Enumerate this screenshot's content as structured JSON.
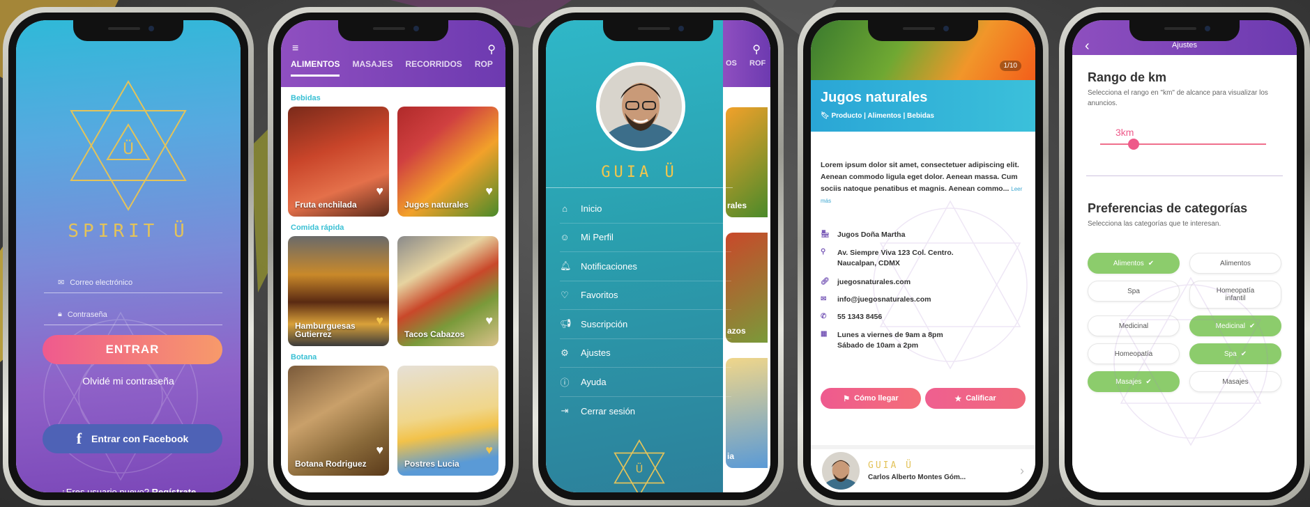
{
  "colors": {
    "accent_pink": "#ef5a8e",
    "purple": "#7b47b8",
    "teal": "#2fb7c8",
    "gold": "#e3c35a",
    "green_chip": "#8ccc6c"
  },
  "login": {
    "brand": "SPIRIT Ü",
    "email_placeholder": "Correo electrónico",
    "password_placeholder": "Contraseña",
    "login_button": "ENTRAR",
    "forgot": "Olvidé mi contraseña",
    "facebook_button": "Entrar con Facebook",
    "new_user": "¿Eres usuario nuevo?",
    "register": "Regístrate"
  },
  "catalog": {
    "tabs": [
      "ALIMENTOS",
      "MASAJES",
      "RECORRIDOS",
      "ROP"
    ],
    "sections": [
      {
        "title": "Bebidas",
        "items": [
          {
            "label": "Fruta enchilada"
          },
          {
            "label": "Jugos naturales"
          }
        ]
      },
      {
        "title": "Comida rápida",
        "items": [
          {
            "label": "Hamburguesas Gutierrez"
          },
          {
            "label": "Tacos Cabazos"
          }
        ]
      },
      {
        "title": "Botana",
        "items": [
          {
            "label": "Botana Rodriguez"
          },
          {
            "label": "Postres Lucia"
          }
        ]
      }
    ],
    "peek_tab": "OS",
    "peek_tab2": "ROF",
    "peek_labels": [
      "rales",
      "azos",
      "ia"
    ]
  },
  "menu": {
    "brand": "GUIA Ü",
    "items": [
      "Inicio",
      "Mi Perfil",
      "Notificaciones",
      "Favoritos",
      "Suscripción",
      "Ajustes",
      "Ayuda",
      "Cerrar sesión"
    ]
  },
  "detail": {
    "pager": "1/10",
    "title": "Jugos naturales",
    "subtitle": "Producto | Alimentos | Bebidas",
    "description": "Lorem ipsum dolor sit amet, consectetuer adipiscing elit. Aenean commodo ligula eget dolor. Aenean massa. Cum sociis natoque penatibus et magnis. Aenean commo...",
    "read_more": "Leer más",
    "business": "Jugos Doña Martha",
    "address": "Av. Siempre Viva 123 Col. Centro. Naucalpan, CDMX",
    "website": "juegosnaturales.com",
    "email": "info@juegosnaturales.com",
    "phone": "55 1343 8456",
    "hours": "Lunes a viernes de 9am a 8pm Sábado de 10am a 2pm",
    "directions_button": "Cómo llegar",
    "rate_button": "Calificar",
    "footer_brand": "GUIA Ü",
    "footer_name": "Carlos Alberto Montes Góm..."
  },
  "settings": {
    "title": "Ajustes",
    "range_title": "Rango de km",
    "range_desc": "Selecciona el rango en \"km\" de alcance para visualizar los anuncios.",
    "range_value": "3km",
    "range_fraction": 0.2,
    "prefs_title": "Preferencias de categorías",
    "prefs_desc": "Selecciona las categorías que te interesan.",
    "chips": [
      {
        "label": "Alimentos",
        "on": true
      },
      {
        "label": "Alimentos",
        "on": false
      },
      {
        "label": "Spa",
        "on": false
      },
      {
        "label": "Homeopatía infantil",
        "on": false
      },
      {
        "label": "Medicinal",
        "on": false
      },
      {
        "label": "Medicinal",
        "on": true
      },
      {
        "label": "Homeopatía",
        "on": false
      },
      {
        "label": "Spa",
        "on": true
      },
      {
        "label": "Masajes",
        "on": true
      },
      {
        "label": "Masajes",
        "on": false
      }
    ]
  }
}
